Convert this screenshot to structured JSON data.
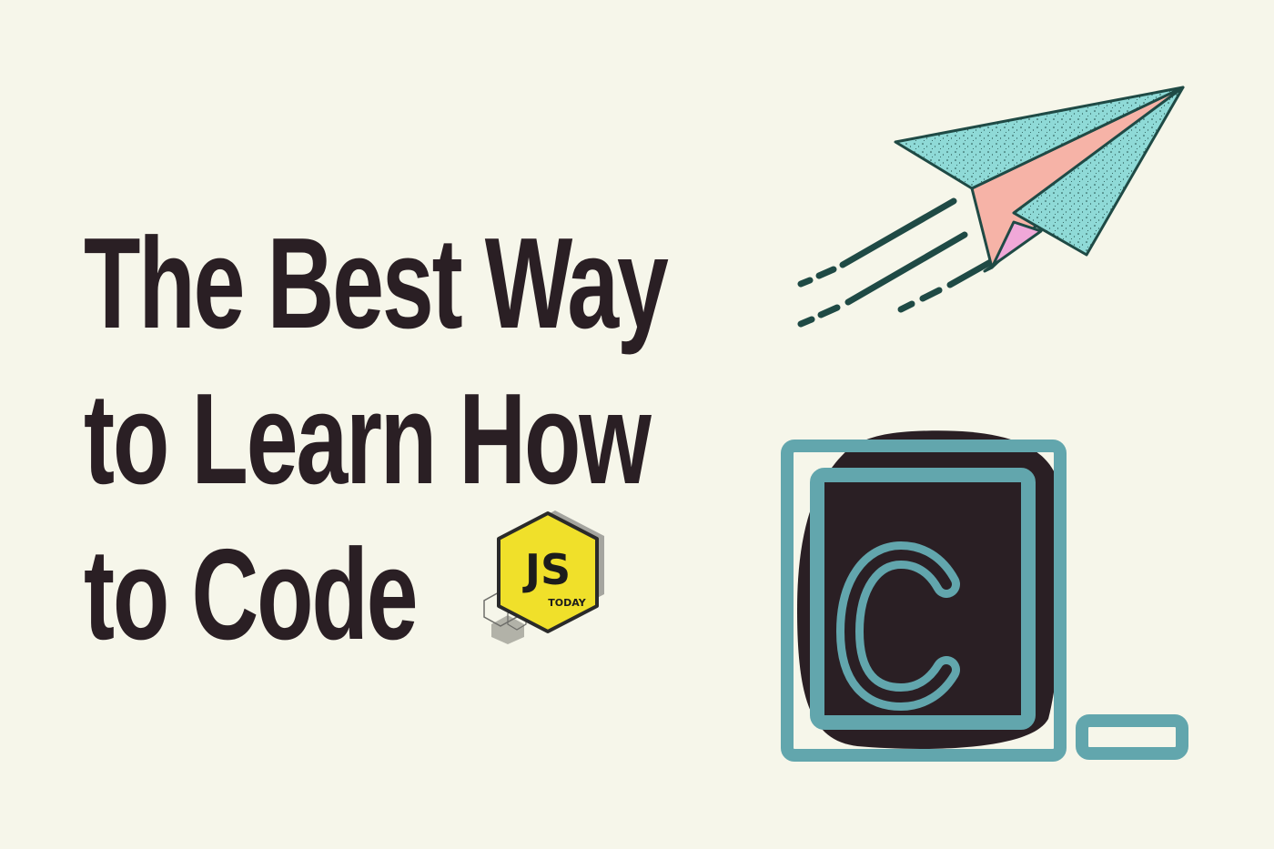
{
  "headline": {
    "line1": "The Best Way",
    "line2": "to Learn How",
    "line3": "to Code"
  },
  "badge": {
    "main_text": "JS",
    "sub_text": "TODAY"
  },
  "colors": {
    "background": "#f6f6ea",
    "text": "#2a1f24",
    "teal": "#62a6ad",
    "dark": "#2a1f24",
    "plane_teal": "#8fdad7",
    "plane_pink": "#f6b3a7",
    "plane_lilac": "#f0a8d8",
    "speed_lines": "#1f4a45",
    "badge_yellow": "#f0e02a",
    "badge_gray": "#8a8a86"
  },
  "icons": {
    "plane": "paper-plane-icon",
    "code": "code-terminal-icon"
  },
  "code_icon": {
    "letter": "C"
  }
}
